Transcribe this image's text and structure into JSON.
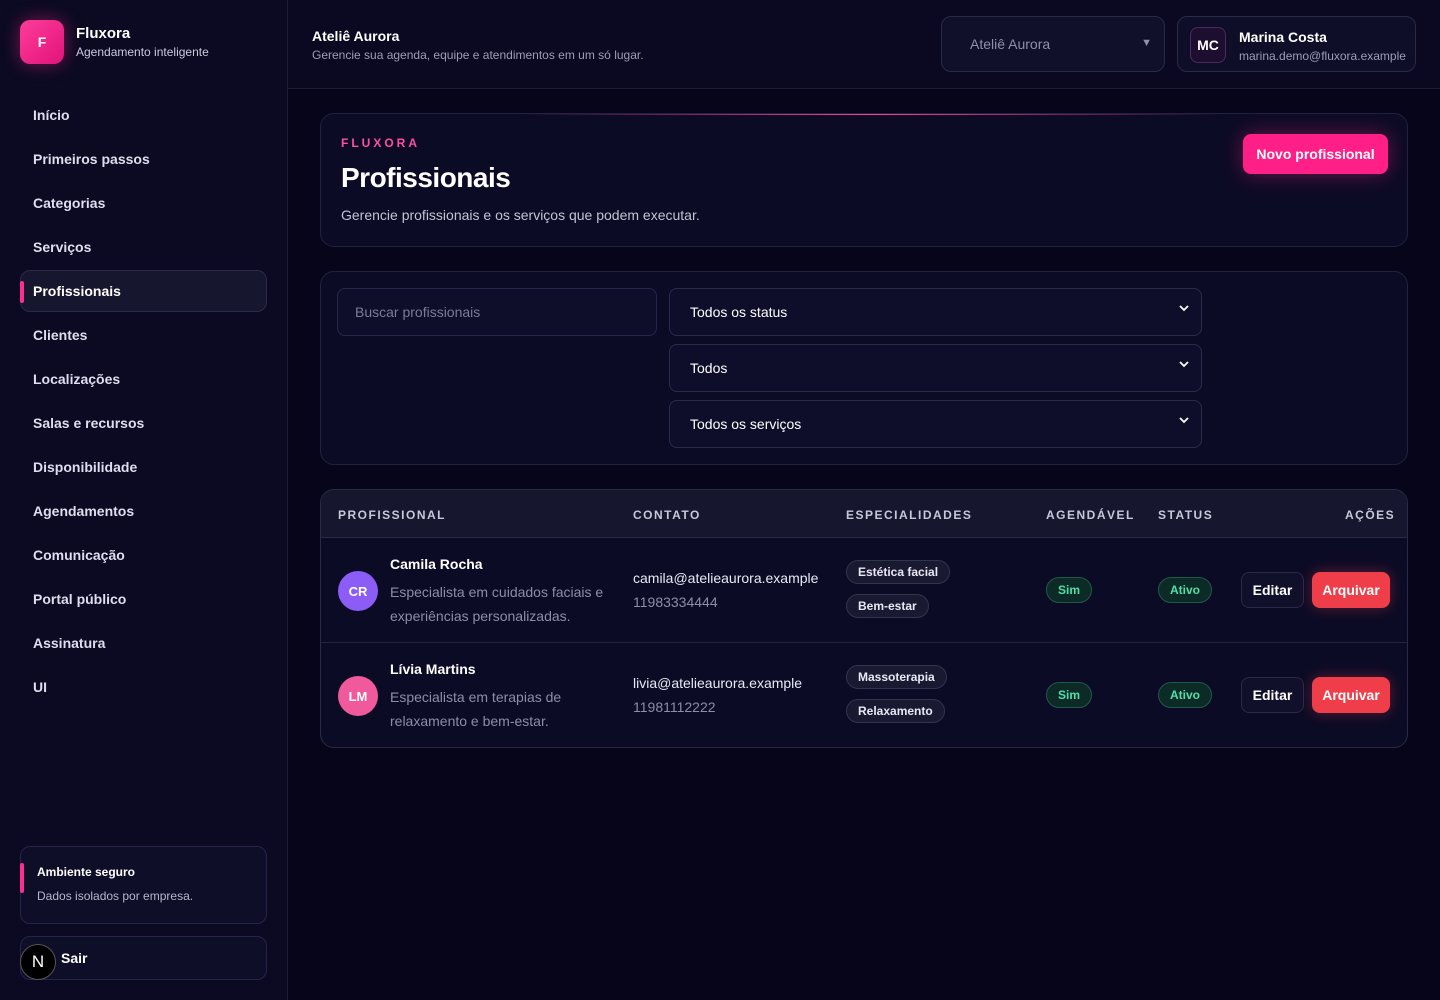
{
  "brand": {
    "logo": "F",
    "name": "Fluxora",
    "subtitle": "Agendamento inteligente"
  },
  "sidebar": {
    "items": [
      {
        "label": "Início"
      },
      {
        "label": "Primeiros passos"
      },
      {
        "label": "Categorias"
      },
      {
        "label": "Serviços"
      },
      {
        "label": "Profissionais",
        "active": true
      },
      {
        "label": "Clientes"
      },
      {
        "label": "Localizações"
      },
      {
        "label": "Salas e recursos"
      },
      {
        "label": "Disponibilidade"
      },
      {
        "label": "Agendamentos"
      },
      {
        "label": "Comunicação"
      },
      {
        "label": "Portal público"
      },
      {
        "label": "Assinatura"
      },
      {
        "label": "UI"
      }
    ],
    "secure_title": "Ambiente seguro",
    "secure_subtitle": "Dados isolados por empresa.",
    "logout_label": "Sair",
    "n_badge": "N"
  },
  "header": {
    "title": "Ateliê Aurora",
    "subtitle": "Gerencie sua agenda, equipe e atendimentos em um só lugar.",
    "company_select": "Ateliê Aurora",
    "user_initials": "MC",
    "user_name": "Marina Costa",
    "user_email": "marina.demo@fluxora.example"
  },
  "hero": {
    "eyebrow": "FLUXORA",
    "title": "Profissionais",
    "description": "Gerencie profissionais e os serviços que podem executar.",
    "new_button": "Novo profissional"
  },
  "filters": {
    "search_placeholder": "Buscar profissionais",
    "status_select": "Todos os status",
    "bookable_select": "Todos",
    "services_select": "Todos os serviços"
  },
  "table": {
    "columns": [
      "PROFISSIONAL",
      "CONTATO",
      "ESPECIALIDADES",
      "AGENDÁVEL",
      "STATUS",
      "AÇÕES"
    ],
    "rows": [
      {
        "initials": "CR",
        "avatar_color": "#8b5cf6",
        "name": "Camila Rocha",
        "bio": "Especialista em cuidados faciais e experiências personalizadas.",
        "email": "camila@atelieaurora.example",
        "phone": "11983334444",
        "specialties": [
          "Estética facial",
          "Bem-estar"
        ],
        "bookable": "Sim",
        "status": "Ativo",
        "edit_label": "Editar",
        "archive_label": "Arquivar"
      },
      {
        "initials": "LM",
        "avatar_color": "#f0599c",
        "name": "Lívia Martins",
        "bio": "Especialista em terapias de relaxamento e bem-estar.",
        "email": "livia@atelieaurora.example",
        "phone": "11981112222",
        "specialties": [
          "Massoterapia",
          "Relaxamento"
        ],
        "bookable": "Sim",
        "status": "Ativo",
        "edit_label": "Editar",
        "archive_label": "Arquivar"
      }
    ]
  }
}
